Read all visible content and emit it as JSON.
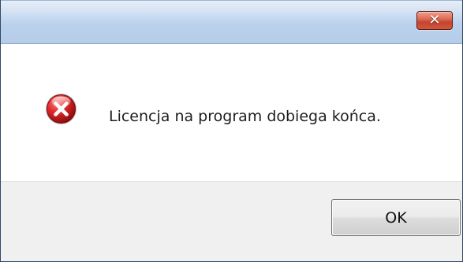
{
  "window": {
    "title": ""
  },
  "title_bar": {
    "close_label": "✕",
    "close_icon": "close-icon"
  },
  "message": {
    "icon": "error-icon",
    "text": "Licencja na program dobiega końca."
  },
  "buttons": {
    "ok_label": "OK"
  },
  "colors": {
    "title_bar": "#bcd2ed",
    "close_button": "#de6d55",
    "error_icon": "#c9141b",
    "button_area": "#f0f0f0"
  }
}
